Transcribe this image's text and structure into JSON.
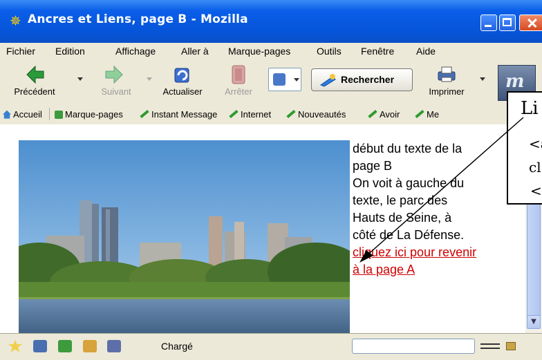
{
  "window": {
    "title": "Ancres et Liens, page B - Mozilla",
    "icon": "mozilla-lizard-icon"
  },
  "menu": [
    "Fichier",
    "Edition",
    "Affichage",
    "Aller à",
    "Marque-pages",
    "Outils",
    "Fenêtre",
    "Aide"
  ],
  "toolbar": {
    "back_label": "Précédent",
    "forward_label": "Suivant",
    "reload_label": "Actualiser",
    "stop_label": "Arrêter",
    "search_label": "Rechercher",
    "print_label": "Imprimer"
  },
  "bookmarks": {
    "home": "Accueil",
    "bookmarks": "Marque-pages",
    "instant_message": "Instant Message",
    "internet": "Internet",
    "news": "Nouveautés",
    "avoir": "Avoir",
    "more": "Me"
  },
  "page": {
    "text_lines": [
      "début du texte de la",
      "page B",
      "On voit à gauche du",
      "texte, le parc des",
      "Hauts de Seine, à",
      "côté de La Défense."
    ],
    "link_lines": [
      "cliquez ici pour revenir",
      "à la page A"
    ],
    "link_color": "#cc0000"
  },
  "callout": {
    "title": "Li",
    "lines": [
      "<a",
      "cl",
      "<"
    ]
  },
  "status": {
    "text": "Chargé"
  },
  "colors": {
    "titlebar": "#0654d8",
    "chrome": "#ece9d8",
    "close_button": "#d54a20"
  }
}
